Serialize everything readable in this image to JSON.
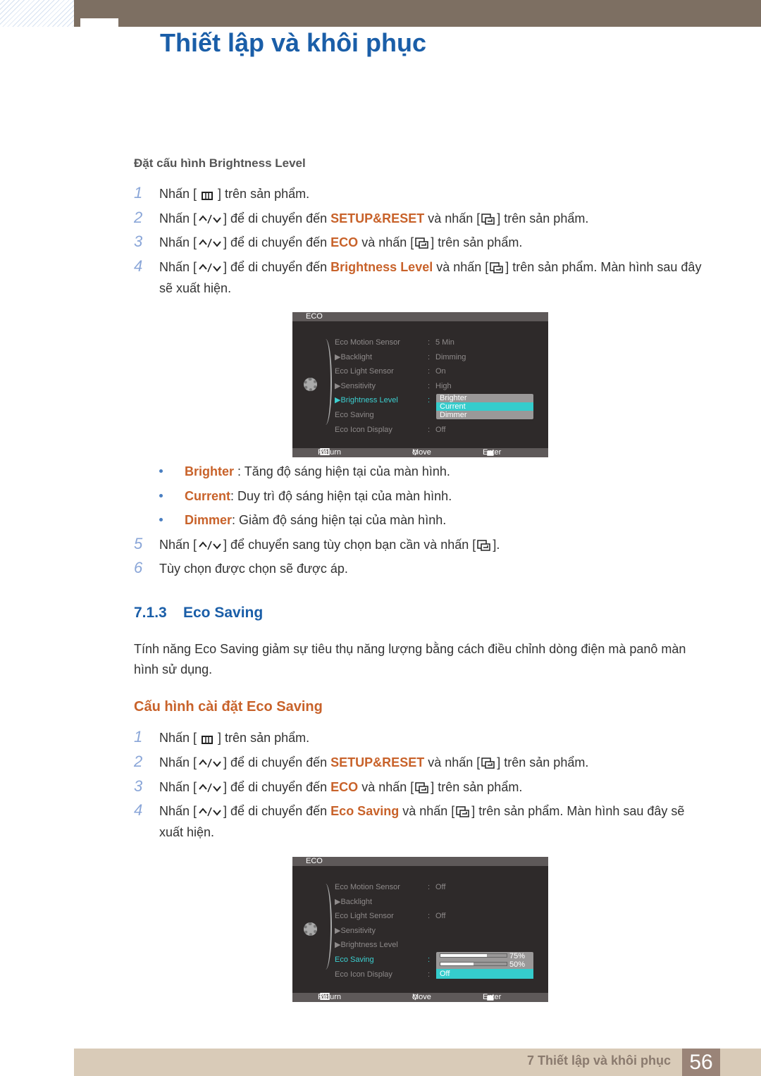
{
  "header": {
    "title": "Thiết lập và khôi phục"
  },
  "section1": {
    "subtitle": "Đặt cấu hình Brightness Level",
    "steps": [
      {
        "num": "1",
        "parts": [
          {
            "t": "Nhấn [ "
          },
          {
            "icon": "menu-icon"
          },
          {
            "t": " ] trên sản phẩm."
          }
        ]
      },
      {
        "num": "2",
        "parts": [
          {
            "t": "Nhấn ["
          },
          {
            "icon": "up-down-icon"
          },
          {
            "t": "] để di chuyển đến "
          },
          {
            "b": "SETUP&RESET"
          },
          {
            "t": " và nhấn ["
          },
          {
            "icon": "enter-icon"
          },
          {
            "t": "] trên sản phẩm."
          }
        ]
      },
      {
        "num": "3",
        "parts": [
          {
            "t": "Nhấn ["
          },
          {
            "icon": "up-down-icon"
          },
          {
            "t": "] để di chuyển đến "
          },
          {
            "b": "ECO"
          },
          {
            "t": " và nhấn ["
          },
          {
            "icon": "enter-icon"
          },
          {
            "t": "] trên sản phẩm."
          }
        ]
      },
      {
        "num": "4",
        "parts": [
          {
            "t": "Nhấn ["
          },
          {
            "icon": "up-down-icon"
          },
          {
            "t": "] để di chuyển đến "
          },
          {
            "b": "Brightness Level"
          },
          {
            "t": " và nhấn ["
          },
          {
            "icon": "enter-icon"
          },
          {
            "t": "] trên sản phẩm. Màn hình sau đây sẽ xuất hiện."
          }
        ]
      }
    ],
    "bullets": [
      {
        "term": "Brighter",
        "text": " : Tăng độ sáng hiện tại của màn hình."
      },
      {
        "term": "Current",
        "text": ": Duy trì độ sáng hiện tại của màn hình."
      },
      {
        "term": "Dimmer",
        "text": ": Giảm độ sáng hiện tại của màn hình."
      }
    ],
    "steps2": [
      {
        "num": "5",
        "parts": [
          {
            "t": "Nhấn ["
          },
          {
            "icon": "up-down-icon"
          },
          {
            "t": "] để chuyển sang tùy chọn bạn cần và nhấn ["
          },
          {
            "icon": "enter-icon"
          },
          {
            "t": "]."
          }
        ]
      },
      {
        "num": "6",
        "parts": [
          {
            "t": "Tùy chọn được chọn sẽ được áp."
          }
        ]
      }
    ]
  },
  "osd1": {
    "title": "ECO",
    "rows": [
      {
        "label": "Eco Motion Sensor",
        "value": "5 Min",
        "colon": ":"
      },
      {
        "label": "▶Backlight",
        "value": "Dimming",
        "colon": ":"
      },
      {
        "label": "Eco Light Sensor",
        "value": "On",
        "colon": ":"
      },
      {
        "label": "▶Sensitivity",
        "value": "High",
        "colon": ":"
      },
      {
        "label": "▶Brightness Level",
        "value": "",
        "colon": ":",
        "active": true
      },
      {
        "label": "Eco Saving",
        "value": "",
        "colon": ""
      },
      {
        "label": "Eco Icon Display",
        "value": "Off",
        "colon": ":"
      }
    ],
    "options": [
      "Brighter",
      "Current",
      "Dimmer"
    ],
    "selected": "Current",
    "footer": {
      "return": "Return",
      "move": "Move",
      "enter": "Enter"
    }
  },
  "section2": {
    "number": "7.1.3",
    "title": "Eco Saving",
    "description": "Tính năng Eco Saving giảm sự tiêu thụ năng lượng bằng cách điều chỉnh dòng điện mà panô màn hình sử dụng.",
    "subtitle": "Cấu hình cài đặt Eco Saving",
    "steps": [
      {
        "num": "1",
        "parts": [
          {
            "t": "Nhấn [ "
          },
          {
            "icon": "menu-icon"
          },
          {
            "t": " ] trên sản phẩm."
          }
        ]
      },
      {
        "num": "2",
        "parts": [
          {
            "t": "Nhấn ["
          },
          {
            "icon": "up-down-icon"
          },
          {
            "t": "] để di chuyển đến "
          },
          {
            "b": "SETUP&RESET"
          },
          {
            "t": " và nhấn ["
          },
          {
            "icon": "enter-icon"
          },
          {
            "t": "] trên sản phẩm."
          }
        ]
      },
      {
        "num": "3",
        "parts": [
          {
            "t": "Nhấn ["
          },
          {
            "icon": "up-down-icon"
          },
          {
            "t": "] để di chuyển đến "
          },
          {
            "b": "ECO"
          },
          {
            "t": " và nhấn ["
          },
          {
            "icon": "enter-icon"
          },
          {
            "t": "] trên sản phẩm."
          }
        ]
      },
      {
        "num": "4",
        "parts": [
          {
            "t": "Nhấn ["
          },
          {
            "icon": "up-down-icon"
          },
          {
            "t": "] để di chuyển đến "
          },
          {
            "b": "Eco Saving"
          },
          {
            "t": " và nhấn ["
          },
          {
            "icon": "enter-icon"
          },
          {
            "t": "] trên sản phẩm. Màn hình sau đây sẽ xuất hiện."
          }
        ]
      }
    ]
  },
  "osd2": {
    "title": "ECO",
    "rows": [
      {
        "label": "Eco Motion Sensor",
        "value": "Off",
        "colon": ":"
      },
      {
        "label": "▶Backlight",
        "value": "",
        "colon": ""
      },
      {
        "label": "Eco Light Sensor",
        "value": "Off",
        "colon": ":"
      },
      {
        "label": "▶Sensitivity",
        "value": "",
        "colon": ""
      },
      {
        "label": "▶Brightness Level",
        "value": "",
        "colon": ""
      },
      {
        "label": "Eco Saving",
        "value": "",
        "colon": ":",
        "active": true
      },
      {
        "label": "Eco Icon Display",
        "value": "",
        "colon": ":"
      }
    ],
    "options": [
      {
        "label": "75%",
        "level": 75
      },
      {
        "label": "50%",
        "level": 50
      },
      {
        "label": "Off"
      }
    ],
    "selected": "Off",
    "footer": {
      "return": "Return",
      "move": "Move",
      "enter": "Enter"
    }
  },
  "footer": {
    "chapter": "7 Thiết lập và khôi phục",
    "page": "56"
  },
  "colors": {
    "accent_blue": "#1a5ea8",
    "highlight_orange": "#c8622a",
    "osd_cyan": "#35cccc",
    "header_brown": "#7d6f62"
  }
}
